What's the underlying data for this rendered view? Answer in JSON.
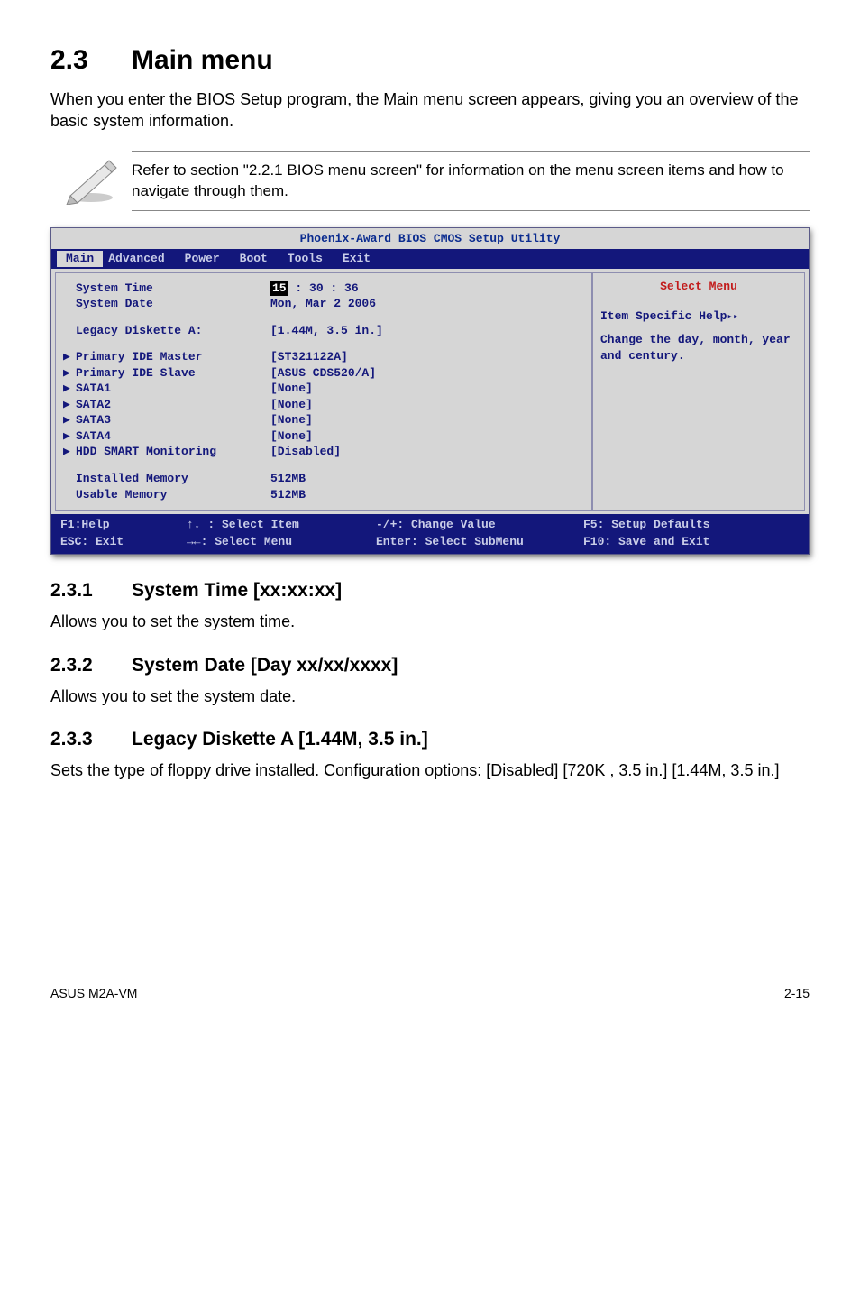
{
  "header": {
    "num": "2.3",
    "title": "Main menu"
  },
  "intro": "When you enter the BIOS Setup program, the Main menu screen appears, giving you an overview of the basic system information.",
  "note": "Refer to section \"2.2.1  BIOS menu screen\" for information on the menu screen items and how to navigate through them.",
  "bios": {
    "utilTitle": "Phoenix-Award BIOS CMOS Setup Utility",
    "tabs": [
      "Main",
      "Advanced",
      "Power",
      "Boot",
      "Tools",
      "Exit"
    ],
    "leftRows": [
      {
        "k": "System Time",
        "v_pre": "",
        "v_hl": "15",
        "v_post": " : 30 : 36",
        "tri": false
      },
      {
        "k": "System Date",
        "v": "Mon, Mar 2  2006",
        "tri": false
      },
      {
        "spacer": true
      },
      {
        "k": "Legacy Diskette A:",
        "v": "[1.44M, 3.5 in.]",
        "tri": false
      },
      {
        "spacer": true
      },
      {
        "k": "Primary IDE Master",
        "v": "[ST321122A]",
        "tri": true
      },
      {
        "k": "Primary IDE Slave",
        "v": "[ASUS CDS520/A]",
        "tri": true
      },
      {
        "k": "SATA1",
        "v": "[None]",
        "tri": true
      },
      {
        "k": "SATA2",
        "v": "[None]",
        "tri": true
      },
      {
        "k": "SATA3",
        "v": "[None]",
        "tri": true
      },
      {
        "k": "SATA4",
        "v": "[None]",
        "tri": true
      },
      {
        "k": "HDD SMART Monitoring",
        "v": "[Disabled]",
        "tri": true
      },
      {
        "spacer": true
      },
      {
        "k": "Installed Memory",
        "v": "512MB",
        "tri": false,
        "indent": true
      },
      {
        "k": "Usable Memory",
        "v": "512MB",
        "tri": false,
        "indent": true
      }
    ],
    "help": {
      "title": "Select Menu",
      "line1": "Item Specific Help",
      "body": "Change the day, month, year and century."
    },
    "footer": {
      "r1c1": "F1:Help",
      "r1c2": "↑↓ : Select Item",
      "r1c3": "-/+: Change Value",
      "r1c4": "F5: Setup Defaults",
      "r2c1": "ESC: Exit",
      "r2c2": "→←: Select Menu",
      "r2c3": "Enter: Select SubMenu",
      "r2c4": "F10: Save and Exit"
    }
  },
  "subs": [
    {
      "num": "2.3.1",
      "title": "System Time [xx:xx:xx]",
      "body": "Allows you to set the system time."
    },
    {
      "num": "2.3.2",
      "title": "System Date [Day xx/xx/xxxx]",
      "body": "Allows you to set the system date."
    },
    {
      "num": "2.3.3",
      "title": "Legacy Diskette A [1.44M, 3.5 in.]",
      "body": "Sets the type of floppy drive installed. Configuration options: [Disabled] [720K , 3.5 in.] [1.44M, 3.5 in.]"
    }
  ],
  "page_footer": {
    "left": "ASUS M2A-VM",
    "right": "2-15"
  }
}
